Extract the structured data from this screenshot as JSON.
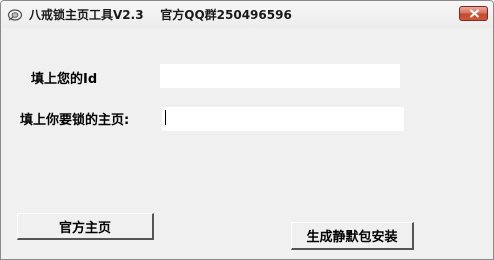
{
  "window": {
    "title": "八戒锁主页工具V2.3    官方QQ群250496596",
    "close_icon": "close-icon",
    "app_icon": "app-logo-icon"
  },
  "form": {
    "id_label": "填上您的Id",
    "id_value": "",
    "homepage_label": "填上你要锁的主页:",
    "homepage_value": ""
  },
  "buttons": {
    "official_homepage": "官方主页",
    "generate_silent_package": "生成静默包安装"
  },
  "colors": {
    "window_bg": "#f0f0f0",
    "close_button": "#c44a2f"
  }
}
